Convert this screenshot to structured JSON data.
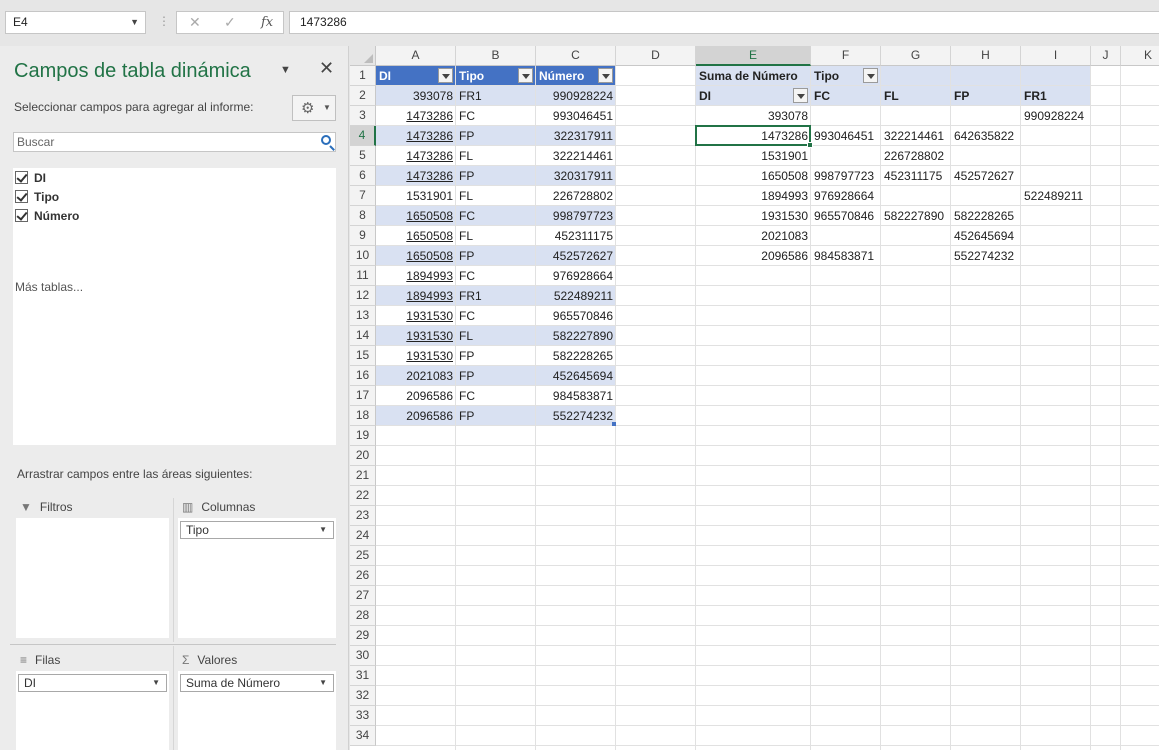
{
  "formula_bar": {
    "name_box": "E4",
    "cancel_symbol": "✕",
    "enter_symbol": "✓",
    "fx_symbol": "fx",
    "value": "1473286"
  },
  "pivot_panel": {
    "title": "Campos de tabla dinámica",
    "subtitle": "Seleccionar campos para agregar al informe:",
    "search_placeholder": "Buscar",
    "fields": [
      {
        "label": "DI",
        "checked": true
      },
      {
        "label": "Tipo",
        "checked": true
      },
      {
        "label": "Número",
        "checked": true
      }
    ],
    "more_tables": "Más tablas...",
    "drag_hint": "Arrastrar campos entre las áreas siguientes:",
    "areas": {
      "filters_label": "Filtros",
      "columns_label": "Columnas",
      "columns_field": "Tipo",
      "rows_label": "Filas",
      "rows_field": "DI",
      "values_label": "Valores",
      "values_field": "Suma de Número"
    }
  },
  "sheet": {
    "columns": [
      "A",
      "B",
      "C",
      "D",
      "E",
      "F",
      "G",
      "H",
      "I",
      "J",
      "K"
    ],
    "rows": [
      "1",
      "2",
      "3",
      "4",
      "5",
      "6",
      "7",
      "8",
      "9",
      "10",
      "11",
      "12",
      "13",
      "14",
      "15",
      "16",
      "17",
      "18",
      "19",
      "20",
      "21",
      "22",
      "23",
      "24",
      "25",
      "26",
      "27",
      "28",
      "29",
      "30",
      "31",
      "32",
      "33",
      "34"
    ],
    "selected_column": "E",
    "selected_row": "4",
    "table": {
      "headers": [
        "DI",
        "Tipo",
        "Número"
      ],
      "rows": [
        {
          "di": "393078",
          "tipo": "FR1",
          "numero": "990928224",
          "link": false
        },
        {
          "di": "1473286",
          "tipo": "FC",
          "numero": "993046451",
          "link": true
        },
        {
          "di": "1473286",
          "tipo": "FP",
          "numero": "322317911",
          "link": true
        },
        {
          "di": "1473286",
          "tipo": "FL",
          "numero": "322214461",
          "link": true
        },
        {
          "di": "1473286",
          "tipo": "FP",
          "numero": "320317911",
          "link": true
        },
        {
          "di": "1531901",
          "tipo": "FL",
          "numero": "226728802",
          "link": false
        },
        {
          "di": "1650508",
          "tipo": "FC",
          "numero": "998797723",
          "link": true
        },
        {
          "di": "1650508",
          "tipo": "FL",
          "numero": "452311175",
          "link": true
        },
        {
          "di": "1650508",
          "tipo": "FP",
          "numero": "452572627",
          "link": true
        },
        {
          "di": "1894993",
          "tipo": "FC",
          "numero": "976928664",
          "link": true
        },
        {
          "di": "1894993",
          "tipo": "FR1",
          "numero": "522489211",
          "link": true
        },
        {
          "di": "1931530",
          "tipo": "FC",
          "numero": "965570846",
          "link": true
        },
        {
          "di": "1931530",
          "tipo": "FL",
          "numero": "582227890",
          "link": true
        },
        {
          "di": "1931530",
          "tipo": "FP",
          "numero": "582228265",
          "link": true
        },
        {
          "di": "2021083",
          "tipo": "FP",
          "numero": "452645694",
          "link": false
        },
        {
          "di": "2096586",
          "tipo": "FC",
          "numero": "984583871",
          "link": false
        },
        {
          "di": "2096586",
          "tipo": "FP",
          "numero": "552274232",
          "link": false
        }
      ]
    },
    "pivot": {
      "values_header": "Suma de Número",
      "columns_header": "Tipo",
      "rows_header": "DI",
      "col_labels": [
        "FC",
        "FL",
        "FP",
        "FR1"
      ],
      "rows": [
        {
          "di": "393078",
          "vals": [
            "",
            "",
            "",
            "990928224"
          ]
        },
        {
          "di": "1473286",
          "vals": [
            "993046451",
            "322214461",
            "642635822",
            ""
          ]
        },
        {
          "di": "1531901",
          "vals": [
            "",
            "226728802",
            "",
            ""
          ]
        },
        {
          "di": "1650508",
          "vals": [
            "998797723",
            "452311175",
            "452572627",
            ""
          ]
        },
        {
          "di": "1894993",
          "vals": [
            "976928664",
            "",
            "",
            "522489211"
          ]
        },
        {
          "di": "1931530",
          "vals": [
            "965570846",
            "582227890",
            "582228265",
            ""
          ]
        },
        {
          "di": "2021083",
          "vals": [
            "",
            "",
            "452645694",
            ""
          ]
        },
        {
          "di": "2096586",
          "vals": [
            "984583871",
            "",
            "552274232",
            ""
          ]
        }
      ]
    }
  }
}
